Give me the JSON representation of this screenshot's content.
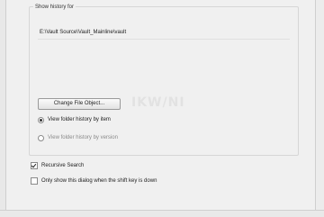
{
  "group": {
    "title": "Show history for"
  },
  "path": {
    "value": "E:\\Vault Source\\Vault_Mainline\\vault"
  },
  "buttons": {
    "change_label": "Change File Object..."
  },
  "options": {
    "radio_folder_label": "View folder history by item",
    "radio_version_label": "View folder history by version",
    "recursive_label": "Recursive Search",
    "shift_label": "Only show this dialog when the shift key is down"
  },
  "state": {
    "radio_folder_checked": true,
    "radio_version_checked": false,
    "recursive_checked": true,
    "shift_checked": false
  },
  "watermark": {
    "text": "IKW/NI"
  }
}
